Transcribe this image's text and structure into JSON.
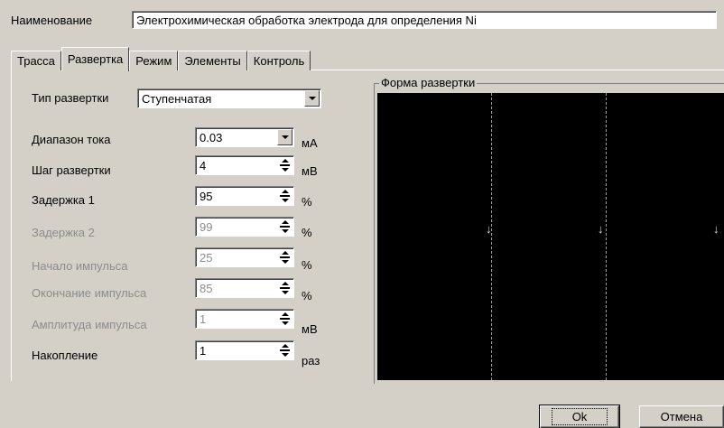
{
  "name": {
    "label": "Наименование",
    "value": "Электрохимическая обработка электрода для определения Ni"
  },
  "tabs": [
    {
      "label": "Трасса"
    },
    {
      "label": "Развертка"
    },
    {
      "label": "Режим"
    },
    {
      "label": "Элементы"
    },
    {
      "label": "Контроль"
    }
  ],
  "active_tab": "Развертка",
  "form": {
    "sweep_type": {
      "label": "Тип развертки",
      "value": "Ступенчатая"
    },
    "current_range": {
      "label": "Диапазон тока",
      "value": "0.03",
      "unit": "мА"
    },
    "sweep_step": {
      "label": "Шаг развертки",
      "value": "4",
      "unit": "мВ"
    },
    "delay1": {
      "label": "Задержка 1",
      "value": "95",
      "unit": "%"
    },
    "delay2": {
      "label": "Задержка 2",
      "value": "99",
      "unit": "%"
    },
    "pulse_start": {
      "label": "Начало импульса",
      "value": "25",
      "unit": "%"
    },
    "pulse_end": {
      "label": "Окончание импульса",
      "value": "85",
      "unit": "%"
    },
    "pulse_amp": {
      "label": "Амплитуда импульса",
      "value": "1",
      "unit": "мВ"
    },
    "accumulation": {
      "label": "Накопление",
      "value": "1",
      "unit": "раз"
    }
  },
  "preview": {
    "title": "Форма развертки",
    "markers": [
      "↓",
      "↓",
      "↓"
    ]
  },
  "buttons": {
    "ok": "Ok",
    "cancel": "Отмена"
  },
  "colors": {
    "dialog_bg": "#d4d0c8",
    "scope_bg": "#000000",
    "disabled_text": "#8c8c8c"
  }
}
